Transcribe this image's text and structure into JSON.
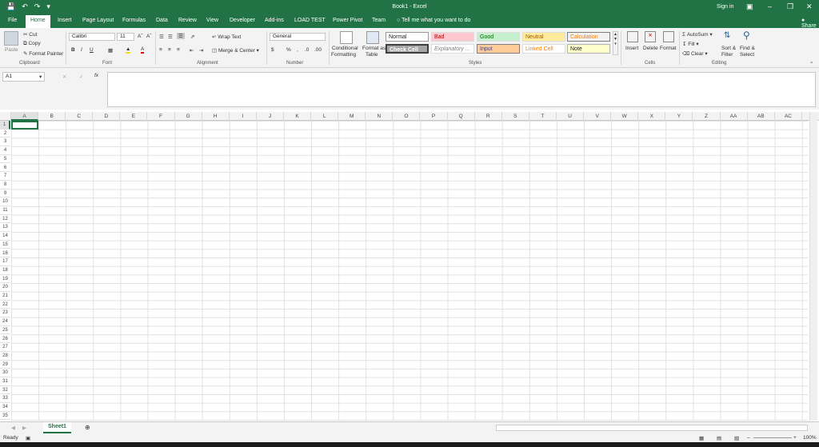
{
  "title": {
    "text": "Book1  -  Excel",
    "signin": "Sign in"
  },
  "quick_access": {
    "save_icon": "save-icon",
    "undo_icon": "undo-icon",
    "redo_icon": "redo-icon",
    "customize_icon": "customize-icon"
  },
  "tabs": [
    "File",
    "Home",
    "Insert",
    "Page Layout",
    "Formulas",
    "Data",
    "Review",
    "View",
    "Developer",
    "Add-ins",
    "LOAD TEST",
    "Power Pivot",
    "Team"
  ],
  "tell_me": "Tell me what you want to do",
  "share": "Share",
  "ribbon": {
    "clipboard": {
      "paste": "Paste",
      "cut": "Cut",
      "copy": "Copy",
      "format_painter": "Format Painter",
      "label": "Clipboard"
    },
    "font": {
      "name": "Calibri",
      "size": "11",
      "bold": "B",
      "italic": "I",
      "underline": "U",
      "label": "Font"
    },
    "alignment": {
      "wrap": "Wrap Text",
      "merge": "Merge & Center",
      "label": "Alignment"
    },
    "number": {
      "format": "General",
      "percent": "%",
      "comma": ",",
      "label": "Number"
    },
    "styles": {
      "conditional_line1": "Conditional",
      "conditional_line2": "Formatting",
      "format_table_line1": "Format as",
      "format_table_line2": "Table",
      "items": [
        "Normal",
        "Bad",
        "Good",
        "Neutral",
        "Calculation",
        "Check Cell",
        "Explanatory ...",
        "Input",
        "Linked Cell",
        "Note"
      ],
      "label": "Styles"
    },
    "cells": {
      "insert": "Insert",
      "delete": "Delete",
      "format": "Format",
      "label": "Cells"
    },
    "editing": {
      "autosum": "AutoSum",
      "fill": "Fill",
      "clear": "Clear",
      "sort_line1": "Sort &",
      "sort_line2": "Filter",
      "find_line1": "Find &",
      "find_line2": "Select",
      "label": "Editing"
    }
  },
  "formula_bar": {
    "name_box": "A1",
    "fx": "fx",
    "value": ""
  },
  "columns": [
    "A",
    "B",
    "C",
    "D",
    "E",
    "F",
    "G",
    "H",
    "I",
    "J",
    "K",
    "L",
    "M",
    "N",
    "O",
    "P",
    "Q",
    "R",
    "S",
    "T",
    "U",
    "V",
    "W",
    "X",
    "Y",
    "Z",
    "AA",
    "AB",
    "AC"
  ],
  "rows": [
    "1",
    "2",
    "3",
    "4",
    "5",
    "6",
    "7",
    "8",
    "9",
    "10",
    "11",
    "12",
    "13",
    "14",
    "15",
    "16",
    "17",
    "18",
    "19",
    "20",
    "21",
    "22",
    "23",
    "24",
    "25",
    "26",
    "27",
    "28",
    "29",
    "30",
    "31",
    "32",
    "33",
    "34",
    "35"
  ],
  "sheet_tabs": [
    "Sheet1"
  ],
  "status": {
    "ready": "Ready",
    "zoom": "100%"
  },
  "colors": {
    "accent": "#217346"
  }
}
